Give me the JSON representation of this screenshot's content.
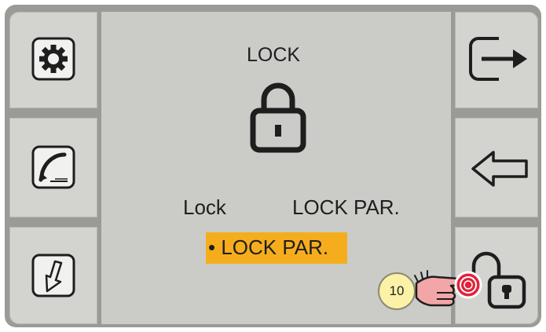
{
  "screen": {
    "title": "LOCK",
    "option_left": "Lock",
    "option_right": "LOCK PAR.",
    "selected_option": "• LOCK PAR."
  },
  "left_buttons": [
    {
      "icon": "gear-icon"
    },
    {
      "icon": "welding-torch-icon"
    },
    {
      "icon": "down-arrow-icon"
    }
  ],
  "right_buttons": [
    {
      "icon": "exit-icon"
    },
    {
      "icon": "back-arrow-icon"
    },
    {
      "icon": "unlock-icon"
    }
  ],
  "annotation": {
    "step_number": "10",
    "pointer_icon": "pointing-hand-icon"
  },
  "colors": {
    "highlight": "#f6ad1d",
    "badge": "#fbf2a7",
    "press_indicator": "#e0233b"
  }
}
